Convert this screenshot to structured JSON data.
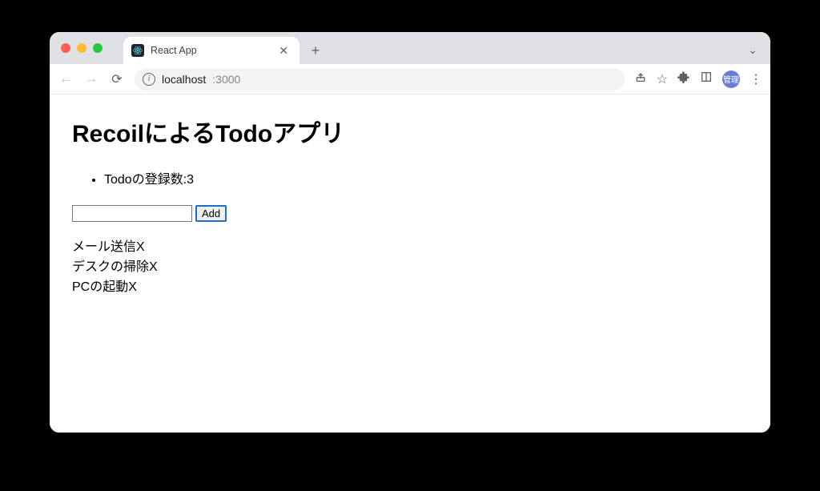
{
  "browser": {
    "tab_title": "React App",
    "url_host": "localhost",
    "url_port": ":3000",
    "profile_badge": "管理"
  },
  "app": {
    "heading": "RecoilによるTodoアプリ",
    "count_label_prefix": "Todoの登録数:",
    "count": "3",
    "add_button_label": "Add",
    "input_value": "",
    "todos": [
      {
        "text": "メール送信",
        "delete": "X"
      },
      {
        "text": "デスクの掃除",
        "delete": "X"
      },
      {
        "text": "PCの起動",
        "delete": "X"
      }
    ]
  }
}
